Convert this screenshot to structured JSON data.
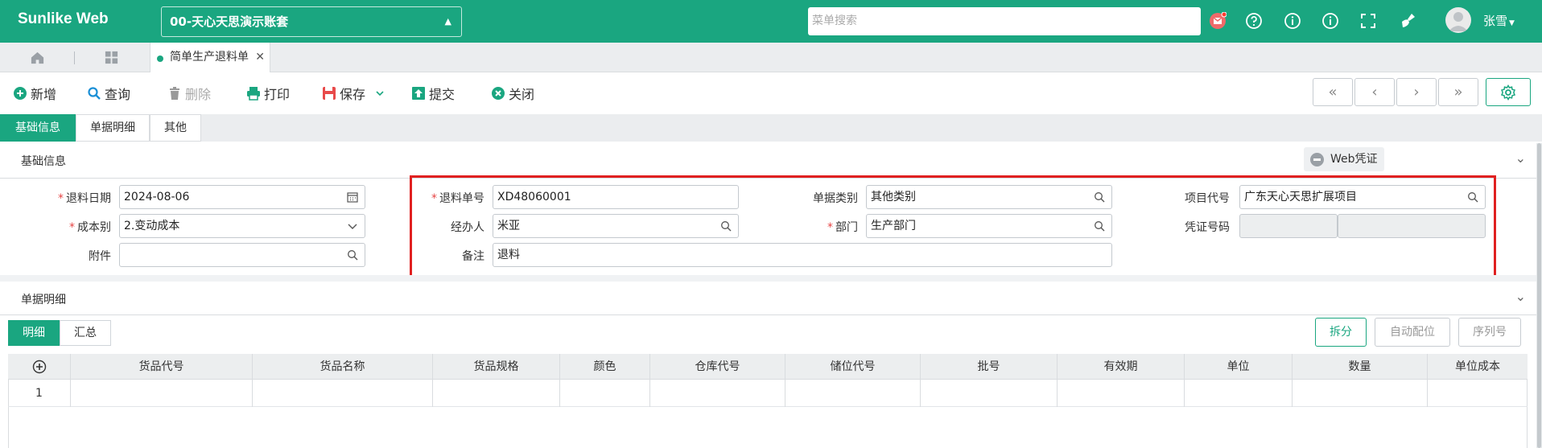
{
  "app": {
    "brand": "Sunlike Web",
    "account": "00-天心天思演示账套",
    "menu_search_placeholder": "菜单搜索",
    "user": "张雪"
  },
  "tabs": {
    "doc_tab": "简单生产退料单"
  },
  "toolbar": {
    "add": "新增",
    "query": "查询",
    "delete": "删除",
    "print": "打印",
    "save": "保存",
    "submit": "提交",
    "close": "关闭"
  },
  "section_tabs": [
    "基础信息",
    "单据明细",
    "其他"
  ],
  "basic": {
    "title": "基础信息",
    "web_cert": "Web凭证",
    "return_date_label": "退料日期",
    "return_date": "2024-08-06",
    "cost_label": "成本别",
    "cost": "2.变动成本",
    "attach_label": "附件",
    "attach": "",
    "return_no_label": "退料单号",
    "return_no": "XD48060001",
    "handler_label": "经办人",
    "handler": "米亚",
    "note_label": "备注",
    "note": "退料",
    "doc_type_label": "单据类别",
    "doc_type": "其他类别",
    "dept_label": "部门",
    "dept": "生产部门",
    "project_label": "项目代号",
    "project": "广东天心天思扩展项目",
    "voucher_label": "凭证号码",
    "voucher_a": "",
    "voucher_b": ""
  },
  "detail": {
    "title": "单据明细",
    "sub_tabs": [
      "明细",
      "汇总"
    ],
    "buttons": {
      "split": "拆分",
      "auto_alloc": "自动配位",
      "serial": "序列号"
    },
    "columns": [
      "货品代号",
      "货品名称",
      "货品规格",
      "颜色",
      "仓库代号",
      "储位代号",
      "批号",
      "有效期",
      "单位",
      "数量",
      "单位成本"
    ],
    "rows": [
      {
        "index": "1"
      }
    ]
  },
  "colors": {
    "brand": "#1aa680",
    "highlight": "#e02020",
    "required": "#e64545"
  }
}
